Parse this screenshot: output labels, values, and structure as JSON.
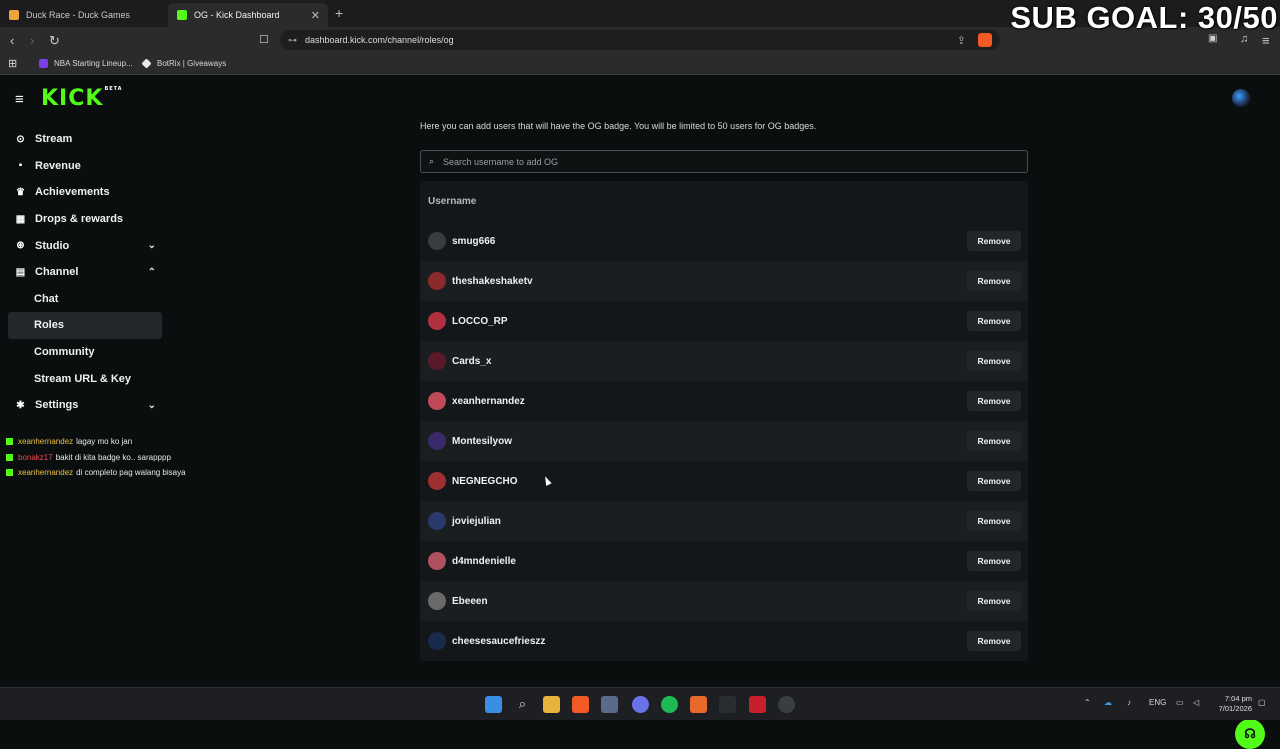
{
  "browser": {
    "tabs": [
      {
        "title": "Duck Race - Duck Games",
        "fav_color": "#f0a53a"
      },
      {
        "title": "OG - Kick Dashboard",
        "fav_color": "#53fc18"
      }
    ],
    "url": "dashboard.kick.com/channel/roles/og",
    "bookmarks": [
      {
        "label": "NBA Starting Lineup...",
        "color": "#7b3fe4"
      },
      {
        "label": "BotRix | Giveaways",
        "color": "#e8e8e8"
      }
    ]
  },
  "overlay": {
    "sub_goal": "SUB GOAL: 30/50"
  },
  "brand": {
    "logo": "KICK",
    "badge": "BETA",
    "accent": "#53fc18"
  },
  "sidebar": {
    "items": [
      {
        "label": "Stream",
        "icon": "broadcast-icon"
      },
      {
        "label": "Revenue",
        "icon": "revenue-icon"
      },
      {
        "label": "Achievements",
        "icon": "trophy-icon"
      },
      {
        "label": "Drops & rewards",
        "icon": "gift-icon"
      },
      {
        "label": "Studio",
        "icon": "studio-icon",
        "chevron": "down"
      },
      {
        "label": "Channel",
        "icon": "channel-icon",
        "chevron": "up"
      },
      {
        "label": "Chat",
        "sub": true
      },
      {
        "label": "Roles",
        "sub": true,
        "active": true
      },
      {
        "label": "Community",
        "sub": true
      },
      {
        "label": "Stream URL & Key",
        "sub": true
      },
      {
        "label": "Settings",
        "icon": "gear-icon",
        "chevron": "down"
      }
    ]
  },
  "chat_overlay": [
    {
      "user": "xeanhernandez",
      "msg": "lagay mo ko jan",
      "color": "#e8c047"
    },
    {
      "user": "bonakz17",
      "msg": "bakit di kita badge ko.. sarapppp",
      "color": "#e24c4c"
    },
    {
      "user": "xeanhernandez",
      "msg": "di completo pag walang bisaya",
      "color": "#e8c047"
    }
  ],
  "main": {
    "description": "Here you can add users that will have the OG badge. You will be limited to 50 users for OG badges.",
    "search_placeholder": "Search username to add OG",
    "column_header": "Username",
    "remove_label": "Remove",
    "users": [
      {
        "name": "smug666",
        "color": "#3a3d40"
      },
      {
        "name": "theshakeshaketv",
        "color": "#8a2a2a"
      },
      {
        "name": "LOCCO_RP",
        "color": "#b03040"
      },
      {
        "name": "Cards_x",
        "color": "#5a1a2a"
      },
      {
        "name": "xeanhernandez",
        "color": "#c04a5a"
      },
      {
        "name": "Montesilyow",
        "color": "#3a2a6a"
      },
      {
        "name": "NEGNEGCHO",
        "color": "#a03030"
      },
      {
        "name": "joviejulian",
        "color": "#2a3a6a"
      },
      {
        "name": "d4mndenielle",
        "color": "#b05060"
      },
      {
        "name": "Ebeeen",
        "color": "#6a6a6a"
      },
      {
        "name": "cheesesaucefrieszz",
        "color": "#1a2a4a"
      }
    ]
  },
  "taskbar": {
    "lang": "ENG",
    "time": "7:04 pm",
    "date": "7/01/2026"
  }
}
